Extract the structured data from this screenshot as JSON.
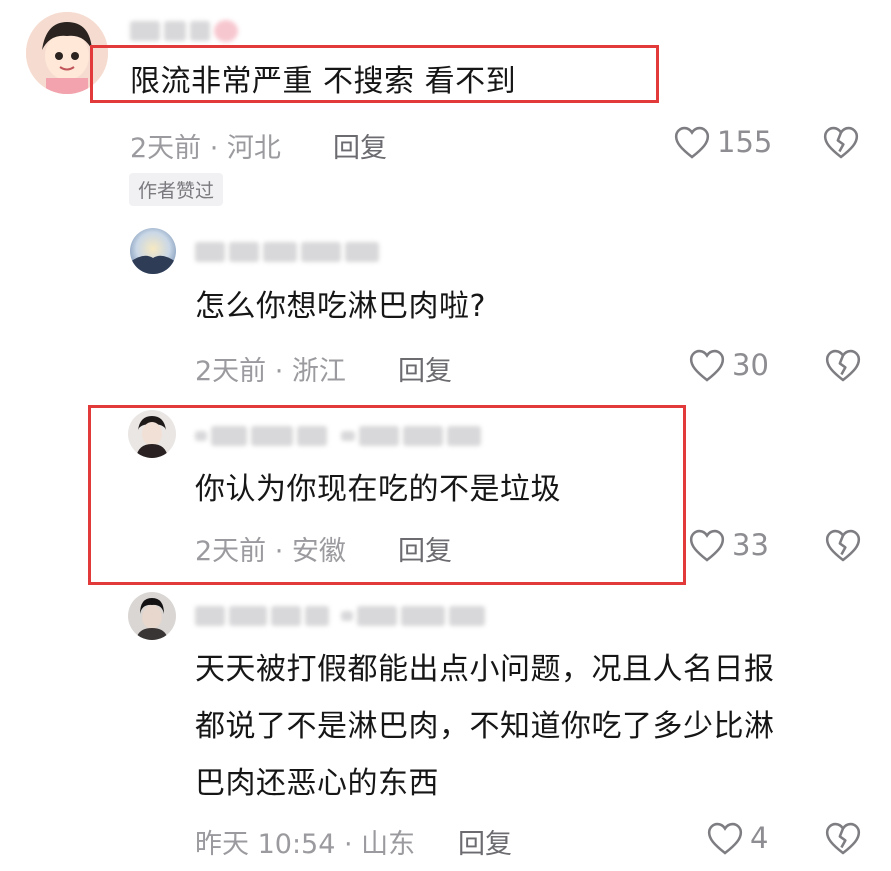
{
  "comments": [
    {
      "text": "限流非常严重 不搜索 看不到",
      "meta": "2天前 · 河北",
      "reply": "回复",
      "likes": "155",
      "badge": "作者赞过"
    },
    {
      "text": "怎么你想吃淋巴肉啦?",
      "meta": "2天前 · 浙江",
      "reply": "回复",
      "likes": "30"
    },
    {
      "text": "你认为你现在吃的不是垃圾",
      "meta": "2天前 · 安徽",
      "reply": "回复",
      "likes": "33"
    },
    {
      "text_lines": [
        "天天被打假都能出点小问题，况且人名日报",
        "都说了不是淋巴肉，不知道你吃了多少比淋",
        "巴肉还恶心的东西"
      ],
      "meta": "昨天 10:54 · 山东",
      "reply": "回复",
      "likes": "4"
    }
  ],
  "colors": {
    "highlight": "#e23a3a",
    "meta_text": "#9b9b9f",
    "icon": "#7d7d82"
  },
  "icons": [
    "heart-outline-icon",
    "broken-heart-icon"
  ]
}
